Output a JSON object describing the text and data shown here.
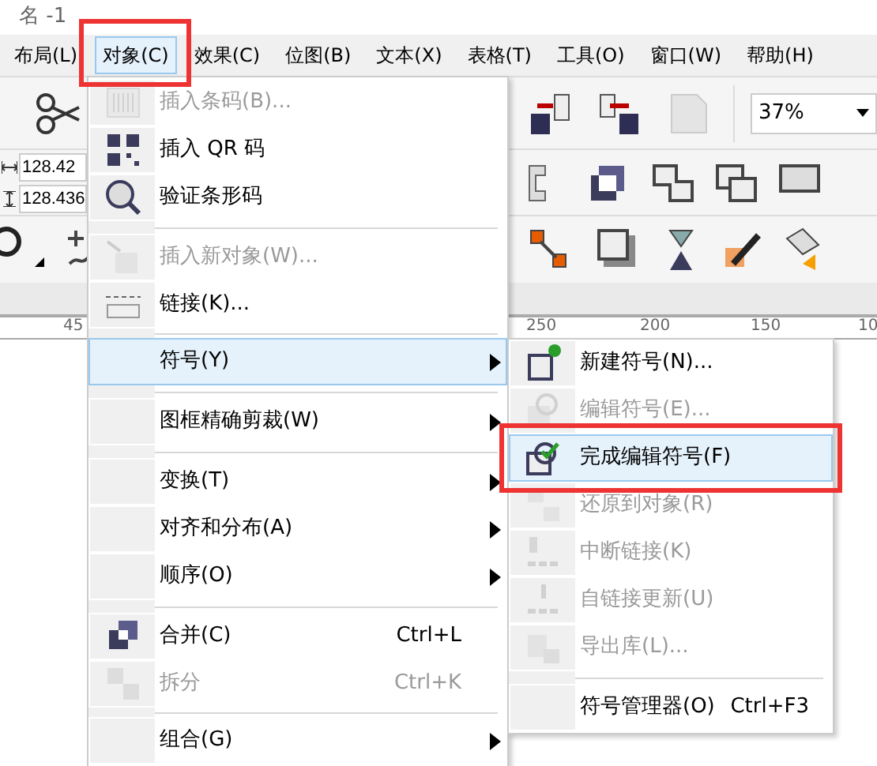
{
  "window": {
    "title": "名 -1"
  },
  "menubar": [
    {
      "label": "布局(L)",
      "selected": false
    },
    {
      "label": "对象(C)",
      "selected": true
    },
    {
      "label": "效果(C)",
      "selected": false
    },
    {
      "label": "位图(B)",
      "selected": false
    },
    {
      "label": "文本(X)",
      "selected": false
    },
    {
      "label": "表格(T)",
      "selected": false
    },
    {
      "label": "工具(O)",
      "selected": false
    },
    {
      "label": "窗口(W)",
      "selected": false
    },
    {
      "label": "帮助(H)",
      "selected": false
    }
  ],
  "toolbar": {
    "zoom": "37%",
    "width_field": "128.42",
    "height_field": "128.436"
  },
  "ruler": {
    "labels": [
      "45",
      "250",
      "200",
      "150",
      "10"
    ]
  },
  "object_menu": [
    {
      "kind": "item",
      "label": "插入条码(B)...",
      "disabled": true,
      "submenu": false,
      "selected": false
    },
    {
      "kind": "item",
      "label": "插入 QR 码",
      "disabled": false,
      "submenu": false,
      "selected": false
    },
    {
      "kind": "item",
      "label": "验证条形码",
      "disabled": false,
      "submenu": false,
      "selected": false
    },
    {
      "kind": "separator"
    },
    {
      "kind": "item",
      "label": "插入新对象(W)...",
      "disabled": true,
      "submenu": false,
      "selected": false
    },
    {
      "kind": "item",
      "label": "链接(K)...",
      "disabled": false,
      "submenu": false,
      "selected": false
    },
    {
      "kind": "separator"
    },
    {
      "kind": "item",
      "label": "符号(Y)",
      "disabled": false,
      "submenu": true,
      "selected": true
    },
    {
      "kind": "separator"
    },
    {
      "kind": "item",
      "label": "图框精确剪裁(W)",
      "disabled": false,
      "submenu": true,
      "selected": false
    },
    {
      "kind": "separator"
    },
    {
      "kind": "item",
      "label": "变换(T)",
      "disabled": false,
      "submenu": true,
      "selected": false
    },
    {
      "kind": "item",
      "label": "对齐和分布(A)",
      "disabled": false,
      "submenu": true,
      "selected": false
    },
    {
      "kind": "item",
      "label": "顺序(O)",
      "disabled": false,
      "submenu": true,
      "selected": false
    },
    {
      "kind": "separator"
    },
    {
      "kind": "item",
      "label": "合并(C)",
      "shortcut": "Ctrl+L",
      "disabled": false,
      "submenu": false,
      "selected": false
    },
    {
      "kind": "item",
      "label": "拆分",
      "shortcut": "Ctrl+K",
      "disabled": true,
      "submenu": false,
      "selected": false
    },
    {
      "kind": "separator"
    },
    {
      "kind": "item",
      "label": "组合(G)",
      "disabled": false,
      "submenu": true,
      "selected": false
    }
  ],
  "symbol_submenu": [
    {
      "kind": "item",
      "label": "新建符号(N)...",
      "disabled": false,
      "selected": false
    },
    {
      "kind": "item",
      "label": "编辑符号(E)...",
      "disabled": true,
      "selected": false
    },
    {
      "kind": "item",
      "label": "完成编辑符号(F)",
      "disabled": false,
      "selected": true
    },
    {
      "kind": "item",
      "label": "还原到对象(R)",
      "disabled": true,
      "selected": false
    },
    {
      "kind": "item",
      "label": "中断链接(K)",
      "disabled": true,
      "selected": false
    },
    {
      "kind": "item",
      "label": "自链接更新(U)",
      "disabled": true,
      "selected": false
    },
    {
      "kind": "item",
      "label": "导出库(L)...",
      "disabled": true,
      "selected": false
    },
    {
      "kind": "separator"
    },
    {
      "kind": "item",
      "label": "符号管理器(O)",
      "shortcut": "Ctrl+F3",
      "disabled": false,
      "selected": false
    }
  ]
}
